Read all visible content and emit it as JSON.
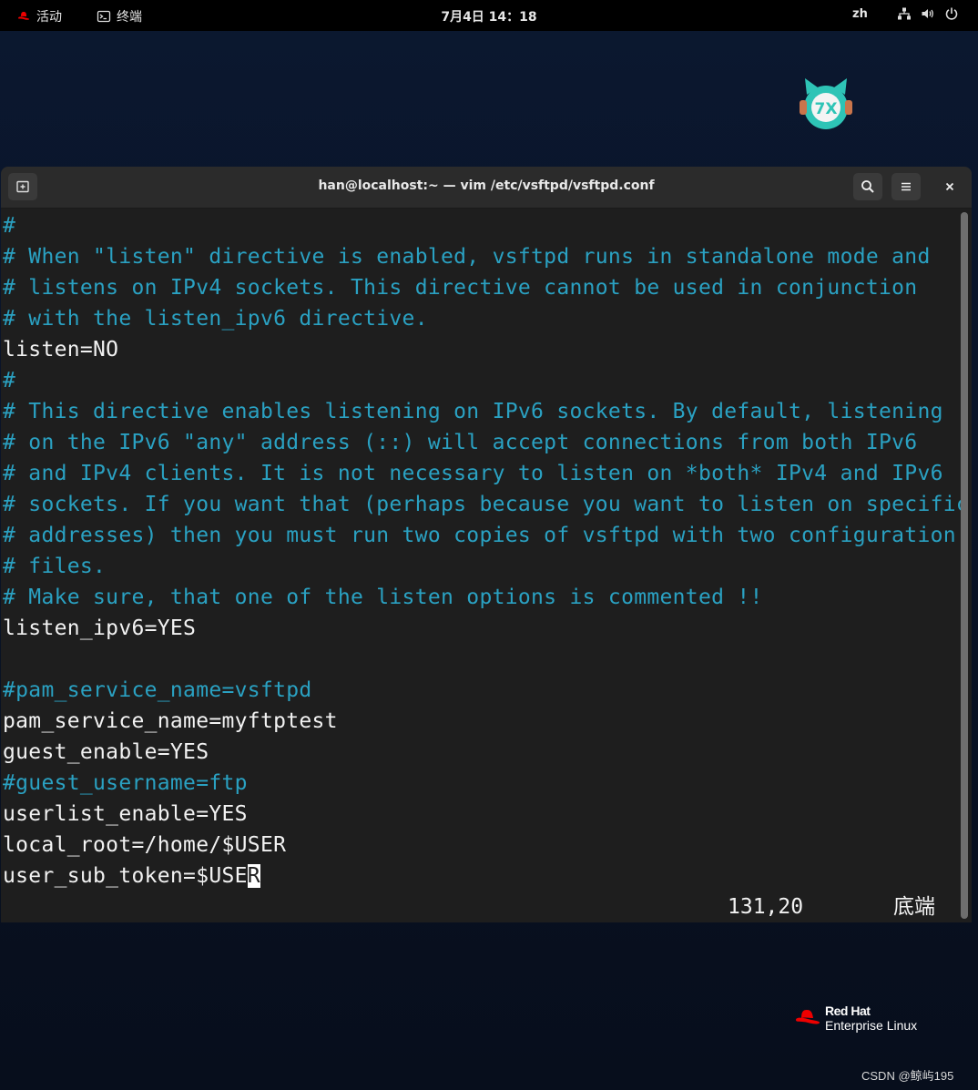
{
  "topbar": {
    "activities_label": "活动",
    "app_label": "终端",
    "clock": "7月4日 14：18",
    "language": "zh"
  },
  "window": {
    "title": "han@localhost:~ — vim /etc/vsftpd/vsftpd.conf"
  },
  "editor": {
    "lines": [
      {
        "text": "#",
        "comment": true
      },
      {
        "text": "# When \"listen\" directive is enabled, vsftpd runs in standalone mode and",
        "comment": true
      },
      {
        "text": "# listens on IPv4 sockets. This directive cannot be used in conjunction",
        "comment": true
      },
      {
        "text": "# with the listen_ipv6 directive.",
        "comment": true
      },
      {
        "text": "listen=NO",
        "comment": false
      },
      {
        "text": "#",
        "comment": true
      },
      {
        "text": "# This directive enables listening on IPv6 sockets. By default, listening",
        "comment": true
      },
      {
        "text": "# on the IPv6 \"any\" address (::) will accept connections from both IPv6",
        "comment": true
      },
      {
        "text": "# and IPv4 clients. It is not necessary to listen on *both* IPv4 and IPv6",
        "comment": true
      },
      {
        "text": "# sockets. If you want that (perhaps because you want to listen on specific",
        "comment": true
      },
      {
        "text": "# addresses) then you must run two copies of vsftpd with two configuration",
        "comment": true
      },
      {
        "text": "# files.",
        "comment": true
      },
      {
        "text": "# Make sure, that one of the listen options is commented !!",
        "comment": true
      },
      {
        "text": "listen_ipv6=YES",
        "comment": false
      },
      {
        "text": "",
        "comment": false
      },
      {
        "text": "#pam_service_name=vsftpd",
        "comment": true
      },
      {
        "text": "pam_service_name=myftptest",
        "comment": false
      },
      {
        "text": "guest_enable=YES",
        "comment": false
      },
      {
        "text": "#guest_username=ftp",
        "comment": true
      },
      {
        "text": "userlist_enable=YES",
        "comment": false
      },
      {
        "text": "local_root=/home/$USER",
        "comment": false
      },
      {
        "text": "user_sub_token=$USE",
        "comment": false,
        "cursor_char": "R"
      }
    ],
    "status_position": "131,20",
    "status_scroll": "底端"
  },
  "branding": {
    "redhat_line1": "Red Hat",
    "redhat_line2": "Enterprise Linux",
    "watermark": "CSDN @鲸屿195"
  },
  "colors": {
    "comment": "#2aa1c2",
    "text": "#f2f2f2",
    "redhat_red": "#ee0000"
  }
}
